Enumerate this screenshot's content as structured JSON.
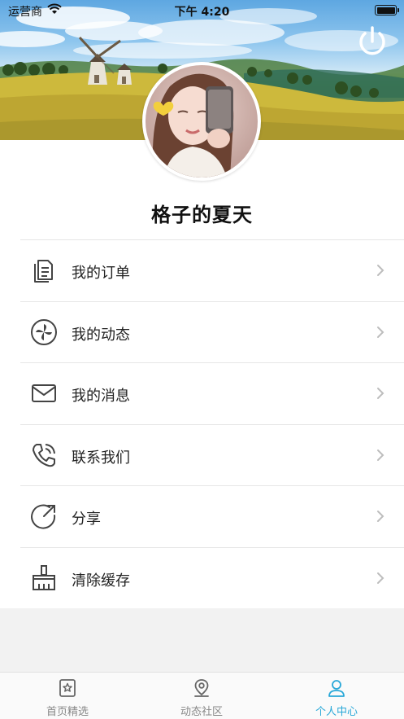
{
  "status_bar": {
    "carrier": "运营商",
    "time": "下午 4:20",
    "battery": "full"
  },
  "header": {
    "power_icon": "power-icon"
  },
  "profile": {
    "username": "格子的夏天"
  },
  "menu": [
    {
      "label": "我的订单",
      "icon": "document-icon"
    },
    {
      "label": "我的动态",
      "icon": "pinwheel-icon"
    },
    {
      "label": "我的消息",
      "icon": "envelope-icon"
    },
    {
      "label": "联系我们",
      "icon": "phone-icon"
    },
    {
      "label": "分享",
      "icon": "share-icon"
    },
    {
      "label": "清除缓存",
      "icon": "broom-icon"
    }
  ],
  "tabbar": [
    {
      "label": "首页精选",
      "icon": "star-frame-icon",
      "active": false
    },
    {
      "label": "动态社区",
      "icon": "location-pin-icon",
      "active": false
    },
    {
      "label": "个人中心",
      "icon": "person-icon",
      "active": true
    }
  ],
  "colors": {
    "accent": "#29a8d8",
    "separator": "#e6e6e6",
    "background": "#f2f2f2"
  }
}
